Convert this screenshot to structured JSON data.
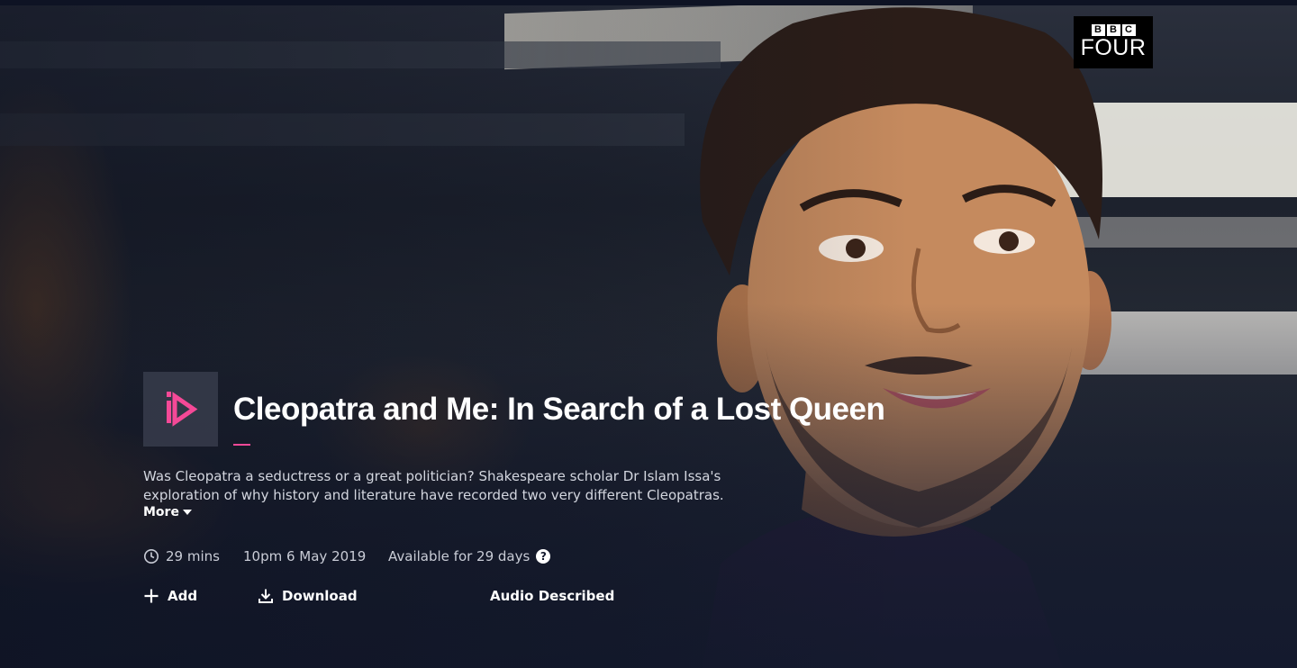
{
  "channel": {
    "brand": "BBC",
    "name": "FOUR"
  },
  "programme": {
    "title": "Cleopatra and Me: In Search of a Lost Queen",
    "synopsis": "Was Cleopatra a seductress or a great politician? Shakespeare scholar Dr Islam Issa's exploration of why history and literature have recorded two very different Cleopatras.",
    "more_label": "More",
    "duration": "29 mins",
    "broadcast": "10pm 6 May 2019",
    "availability": "Available for 29 days"
  },
  "actions": {
    "add_label": "Add",
    "download_label": "Download",
    "audio_described_label": "Audio Described"
  },
  "icons": {
    "programme": "iplayer-logo-icon",
    "duration": "clock-icon",
    "availability_help": "help-icon",
    "add": "plus-icon",
    "download": "download-icon"
  },
  "colors": {
    "accent": "#f54997",
    "background": "#141a2e",
    "channel_logo_bg": "#000000"
  }
}
